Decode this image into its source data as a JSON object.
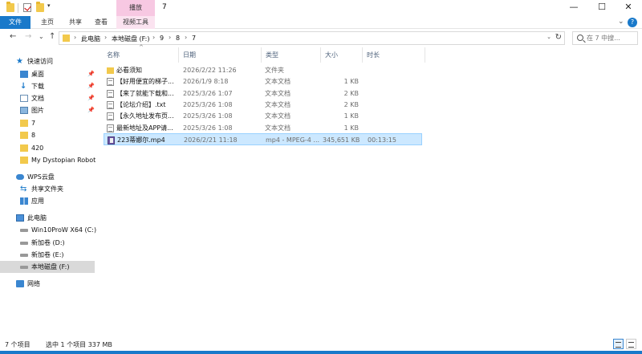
{
  "window": {
    "title": "7",
    "context_tab_header": "播放",
    "minimize": "—",
    "maximize": "☐",
    "close": "✕"
  },
  "ribbon": {
    "tabs": [
      "文件",
      "主页",
      "共享",
      "查看",
      "视频工具"
    ],
    "help": "?"
  },
  "address": {
    "back": "←",
    "forward": "→",
    "recent": "⌄",
    "up": "↑",
    "crumbs": [
      "此电脑",
      "本地磁盘 (F:)",
      "9",
      "8",
      "7"
    ],
    "search_placeholder": "在 7 中搜..."
  },
  "navpane": {
    "quick_access": "快速访问",
    "items": [
      {
        "label": "桌面",
        "pinned": true
      },
      {
        "label": "下载",
        "pinned": true
      },
      {
        "label": "文档",
        "pinned": true
      },
      {
        "label": "图片",
        "pinned": true
      },
      {
        "label": "7"
      },
      {
        "label": "8"
      },
      {
        "label": "420"
      },
      {
        "label": "My Dystopian Robot"
      }
    ],
    "wps": "WPS云盘",
    "wps_items": [
      "共享文件夹",
      "应用"
    ],
    "this_pc": "此电脑",
    "drives": [
      "Win10ProW X64 (C:)",
      "新加卷 (D:)",
      "新加卷 (E:)",
      "本地磁盘 (F:)"
    ],
    "network": "网络"
  },
  "columns": {
    "name": "名称",
    "date": "日期",
    "type": "类型",
    "size": "大小",
    "length": "时长"
  },
  "files": [
    {
      "name": "必看须知",
      "date": "2026/2/22 11:26",
      "type": "文件夹",
      "size": "",
      "length": "",
      "icon": "folder-icon"
    },
    {
      "name": "【好用便宜的梯子...",
      "date": "2026/1/9 8:18",
      "type": "文本文档",
      "size": "1 KB",
      "length": "",
      "icon": "text-file-icon"
    },
    {
      "name": "【来了就能下载和...",
      "date": "2025/3/26 1:07",
      "type": "文本文档",
      "size": "2 KB",
      "length": "",
      "icon": "text-file-icon"
    },
    {
      "name": "【论坛介绍】.txt",
      "date": "2025/3/26 1:08",
      "type": "文本文档",
      "size": "2 KB",
      "length": "",
      "icon": "text-file-icon"
    },
    {
      "name": "【永久地址发布页...",
      "date": "2025/3/26 1:08",
      "type": "文本文档",
      "size": "1 KB",
      "length": "",
      "icon": "text-file-icon"
    },
    {
      "name": "最新地址及APP请...",
      "date": "2025/3/26 1:08",
      "type": "文本文档",
      "size": "1 KB",
      "length": "",
      "icon": "text-file-icon"
    },
    {
      "name": "223蒂娜尔.mp4",
      "date": "2026/2/21 11:18",
      "type": "mp4 - MPEG-4 ...",
      "size": "345,651 KB",
      "length": "00:13:15",
      "icon": "video-file-icon",
      "selected": true
    }
  ],
  "status": {
    "count": "7 个项目",
    "selection": "选中 1 个项目  337 MB"
  }
}
